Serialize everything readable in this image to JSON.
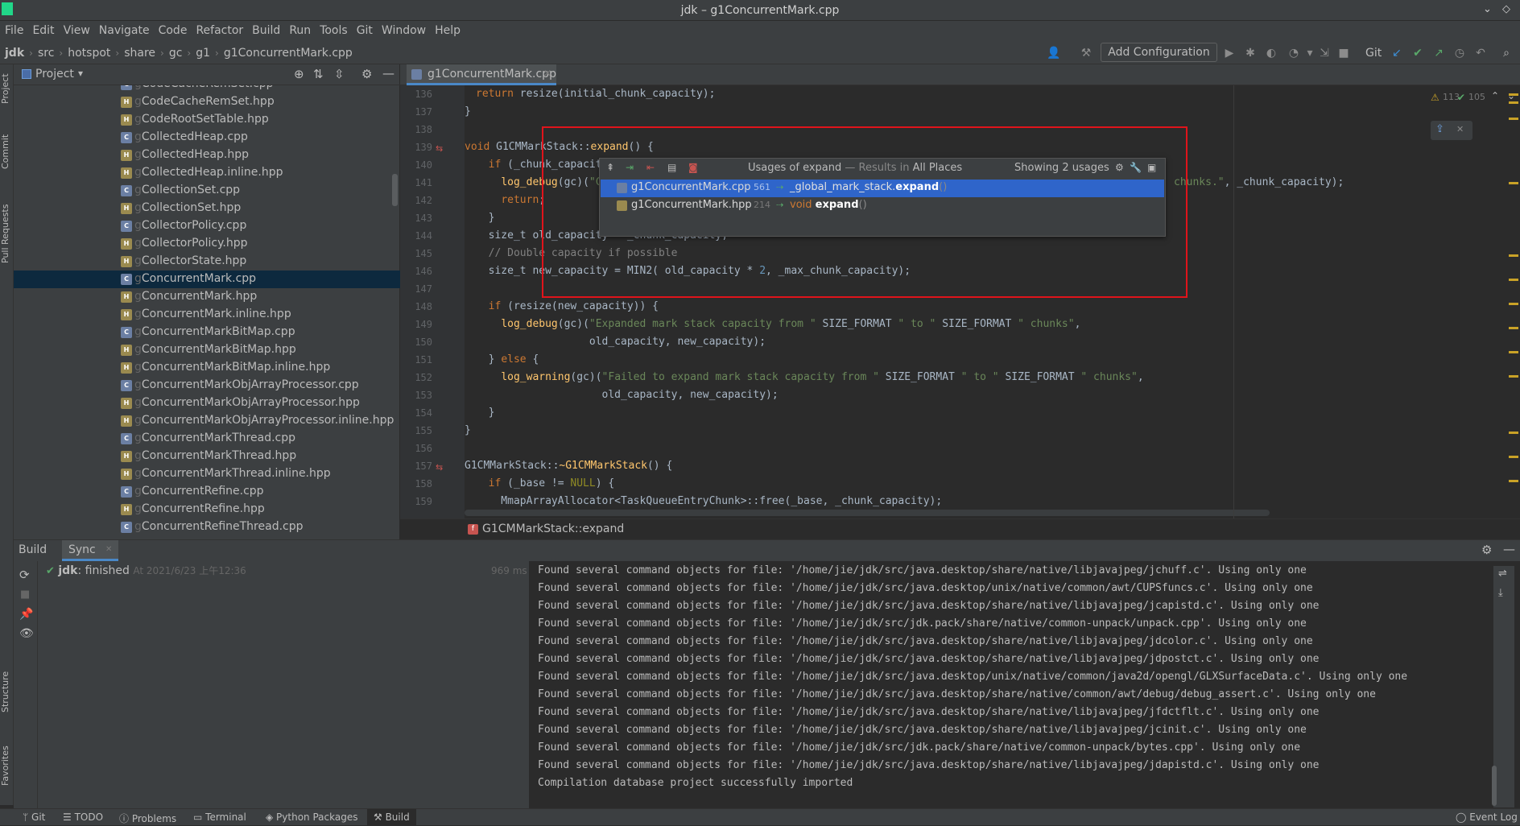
{
  "window": {
    "title": "jdk – g1ConcurrentMark.cpp"
  },
  "menu": [
    "File",
    "Edit",
    "View",
    "Navigate",
    "Code",
    "Refactor",
    "Build",
    "Run",
    "Tools",
    "Git",
    "Window",
    "Help"
  ],
  "breadcrumb": [
    "jdk",
    "src",
    "hotspot",
    "share",
    "gc",
    "g1",
    "g1ConcurrentMark.cpp"
  ],
  "toolbar": {
    "add_config": "Add Configuration",
    "git_label": "Git"
  },
  "left_tool_labels": [
    "Project",
    "Commit",
    "Pull Requests",
    "Structure",
    "Favorites"
  ],
  "project": {
    "header": "Project",
    "files": [
      {
        "prefix": "g",
        "name": "CodeCacheRemSet.cpp",
        "type": "cpp"
      },
      {
        "prefix": "g",
        "name": "CodeCacheRemSet.hpp",
        "type": "hpp"
      },
      {
        "prefix": "g",
        "name": "CodeRootSetTable.hpp",
        "type": "hpp"
      },
      {
        "prefix": "g",
        "name": "CollectedHeap.cpp",
        "type": "cpp"
      },
      {
        "prefix": "g",
        "name": "CollectedHeap.hpp",
        "type": "hpp"
      },
      {
        "prefix": "g",
        "name": "CollectedHeap.inline.hpp",
        "type": "hpp"
      },
      {
        "prefix": "g",
        "name": "CollectionSet.cpp",
        "type": "cpp"
      },
      {
        "prefix": "g",
        "name": "CollectionSet.hpp",
        "type": "hpp"
      },
      {
        "prefix": "g",
        "name": "CollectorPolicy.cpp",
        "type": "cpp"
      },
      {
        "prefix": "g",
        "name": "CollectorPolicy.hpp",
        "type": "hpp"
      },
      {
        "prefix": "g",
        "name": "CollectorState.hpp",
        "type": "hpp"
      },
      {
        "prefix": "g",
        "name": "ConcurrentMark.cpp",
        "type": "cpp",
        "selected": true
      },
      {
        "prefix": "g",
        "name": "ConcurrentMark.hpp",
        "type": "hpp"
      },
      {
        "prefix": "g",
        "name": "ConcurrentMark.inline.hpp",
        "type": "hpp"
      },
      {
        "prefix": "g",
        "name": "ConcurrentMarkBitMap.cpp",
        "type": "cpp"
      },
      {
        "prefix": "g",
        "name": "ConcurrentMarkBitMap.hpp",
        "type": "hpp"
      },
      {
        "prefix": "g",
        "name": "ConcurrentMarkBitMap.inline.hpp",
        "type": "hpp"
      },
      {
        "prefix": "g",
        "name": "ConcurrentMarkObjArrayProcessor.cpp",
        "type": "cpp"
      },
      {
        "prefix": "g",
        "name": "ConcurrentMarkObjArrayProcessor.hpp",
        "type": "hpp"
      },
      {
        "prefix": "g",
        "name": "ConcurrentMarkObjArrayProcessor.inline.hpp",
        "type": "hpp"
      },
      {
        "prefix": "g",
        "name": "ConcurrentMarkThread.cpp",
        "type": "cpp"
      },
      {
        "prefix": "g",
        "name": "ConcurrentMarkThread.hpp",
        "type": "hpp"
      },
      {
        "prefix": "g",
        "name": "ConcurrentMarkThread.inline.hpp",
        "type": "hpp"
      },
      {
        "prefix": "g",
        "name": "ConcurrentRefine.cpp",
        "type": "cpp"
      },
      {
        "prefix": "g",
        "name": "ConcurrentRefine.hpp",
        "type": "hpp"
      },
      {
        "prefix": "g",
        "name": "ConcurrentRefineThread.cpp",
        "type": "cpp"
      }
    ]
  },
  "editor": {
    "tab": "g1ConcurrentMark.cpp",
    "inspections": {
      "warnings": "113",
      "ok": "105"
    },
    "line_numbers": [
      "136",
      "137",
      "138",
      "139",
      "140",
      "141",
      "142",
      "143",
      "144",
      "145",
      "146",
      "147",
      "148",
      "149",
      "150",
      "151",
      "152",
      "153",
      "154",
      "155",
      "156",
      "157",
      "158",
      "159"
    ],
    "bottom_breadcrumb": "G1CMMarkStack::expand"
  },
  "usages_popup": {
    "title": "Usages of expand",
    "scope_prefix": "— Results in",
    "scope": "All Places",
    "showing": "Showing 2 usages",
    "rows": [
      {
        "file": "g1ConcurrentMark.cpp",
        "line": "561",
        "context": "_global_mark_stack.",
        "method": "expand",
        "suffix": "()",
        "selected": true
      },
      {
        "file": "g1ConcurrentMark.hpp",
        "line": "214",
        "context": "void ",
        "method": "expand",
        "suffix": "()",
        "selected": false
      }
    ]
  },
  "build": {
    "tabs": [
      "Build",
      "Sync"
    ],
    "status_project": "jdk",
    "status_text": ": finished",
    "status_time": "At 2021/6/23 上午12:36",
    "duration": "969 ms",
    "output": [
      "Found several command objects for file: '/home/jie/jdk/src/java.desktop/share/native/libjavajpeg/jchuff.c'. Using only one",
      "Found several command objects for file: '/home/jie/jdk/src/java.desktop/unix/native/common/awt/CUPSfuncs.c'. Using only one",
      "Found several command objects for file: '/home/jie/jdk/src/java.desktop/share/native/libjavajpeg/jcapistd.c'. Using only one",
      "Found several command objects for file: '/home/jie/jdk/src/jdk.pack/share/native/common-unpack/unpack.cpp'. Using only one",
      "Found several command objects for file: '/home/jie/jdk/src/java.desktop/share/native/libjavajpeg/jdcolor.c'. Using only one",
      "Found several command objects for file: '/home/jie/jdk/src/java.desktop/share/native/libjavajpeg/jdpostct.c'. Using only one",
      "Found several command objects for file: '/home/jie/jdk/src/java.desktop/unix/native/common/java2d/opengl/GLXSurfaceData.c'. Using only one",
      "Found several command objects for file: '/home/jie/jdk/src/java.desktop/share/native/common/awt/debug/debug_assert.c'. Using only one",
      "Found several command objects for file: '/home/jie/jdk/src/java.desktop/share/native/libjavajpeg/jfdctflt.c'. Using only one",
      "Found several command objects for file: '/home/jie/jdk/src/java.desktop/share/native/libjavajpeg/jcinit.c'. Using only one",
      "Found several command objects for file: '/home/jie/jdk/src/jdk.pack/share/native/common-unpack/bytes.cpp'. Using only one",
      "Found several command objects for file: '/home/jie/jdk/src/java.desktop/share/native/libjavajpeg/jdapistd.c'. Using only one",
      "Compilation database project successfully imported"
    ]
  },
  "statusbar": {
    "items": [
      "Git",
      "TODO",
      "Problems",
      "Terminal",
      "Python Packages",
      "Build"
    ],
    "event_log": "Event Log"
  },
  "colors": {
    "selection": "#2f65ca",
    "tree_selection": "#0d293e",
    "highlight_box": "#e0141b"
  }
}
